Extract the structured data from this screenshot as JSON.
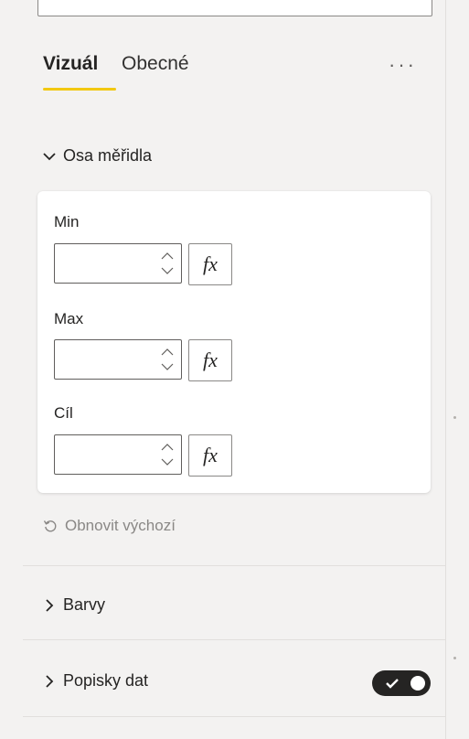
{
  "tabs": [
    {
      "label": "Vizuál",
      "active": true
    },
    {
      "label": "Obecné",
      "active": false
    }
  ],
  "more_options_icon": "more-horizontal-icon",
  "gauge_axis": {
    "title": "Osa měřidla",
    "expanded": true,
    "fields": [
      {
        "label": "Min",
        "value": "",
        "fx_label": "fx"
      },
      {
        "label": "Max",
        "value": "",
        "fx_label": "fx"
      },
      {
        "label": "Cíl",
        "value": "",
        "fx_label": "fx"
      }
    ],
    "reset_label": "Obnovit výchozí"
  },
  "sections": [
    {
      "title": "Barvy",
      "expanded": false
    },
    {
      "title": "Popisky dat",
      "expanded": false,
      "toggle_on": true
    }
  ],
  "colors": {
    "accent": "#f2c811",
    "toggle_on": "#252423"
  }
}
